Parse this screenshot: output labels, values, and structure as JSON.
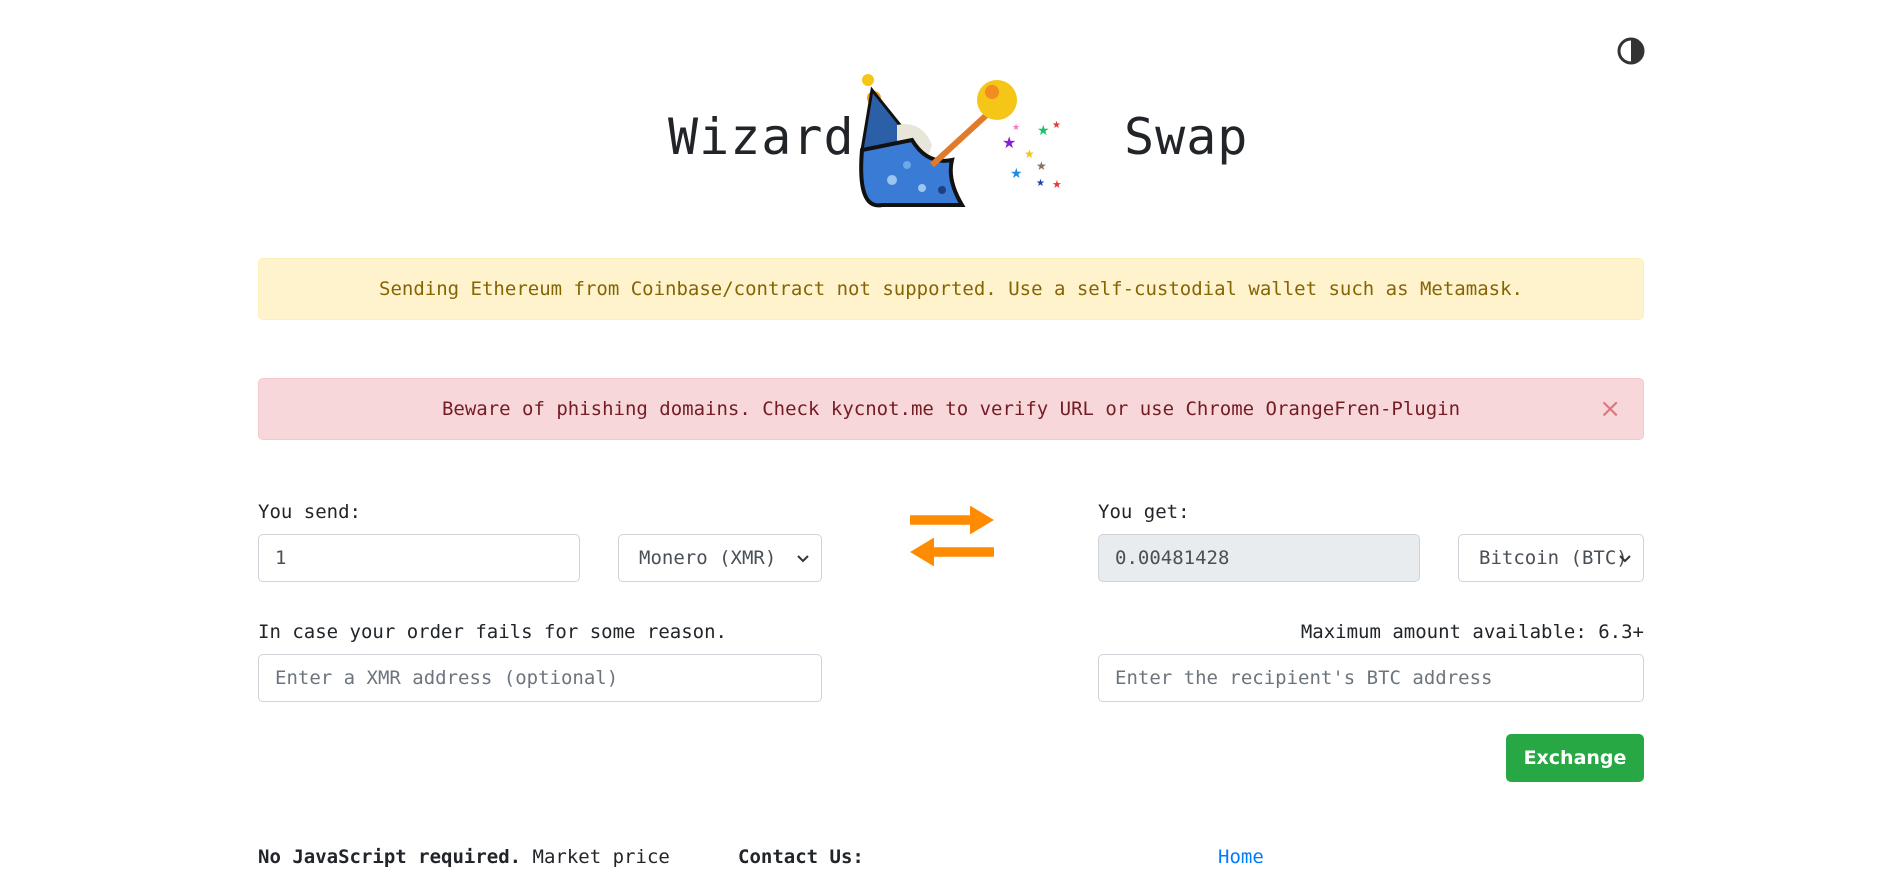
{
  "theme_toggle": {
    "icon": "half-circle-contrast-icon"
  },
  "logo": {
    "left_word": "Wizard",
    "right_word": "Swap",
    "image": "wizard-casting-stars-illustration"
  },
  "alerts": {
    "warning": "Sending Ethereum from Coinbase/contract not supported. Use a self-custodial wallet such as Metamask.",
    "danger": "Beware of phishing domains. Check kycnot.me to verify URL or use Chrome OrangeFren-Plugin",
    "close_symbol": "×"
  },
  "send": {
    "label": "You send:",
    "amount": "1",
    "currency": "Monero (XMR)"
  },
  "get": {
    "label": "You get:",
    "amount": "0.00481428",
    "currency": "Bitcoin (BTC)"
  },
  "refund": {
    "label": "In case your order fails for some reason.",
    "placeholder": "Enter a XMR address (optional)"
  },
  "recipient": {
    "max_label": "Maximum amount available: 6.3+",
    "placeholder": "Enter the recipient's BTC address"
  },
  "exchange_button": "Exchange",
  "swap_icon": "swap-arrows-icon",
  "colors": {
    "accent_orange": "#ff8c00",
    "success_green": "#28a745",
    "link_blue": "#007bff"
  },
  "footer": {
    "col1_bold": "No JavaScript required.",
    "col1_text": " Market price",
    "col2": "Contact Us:",
    "col3_link": "Home"
  }
}
